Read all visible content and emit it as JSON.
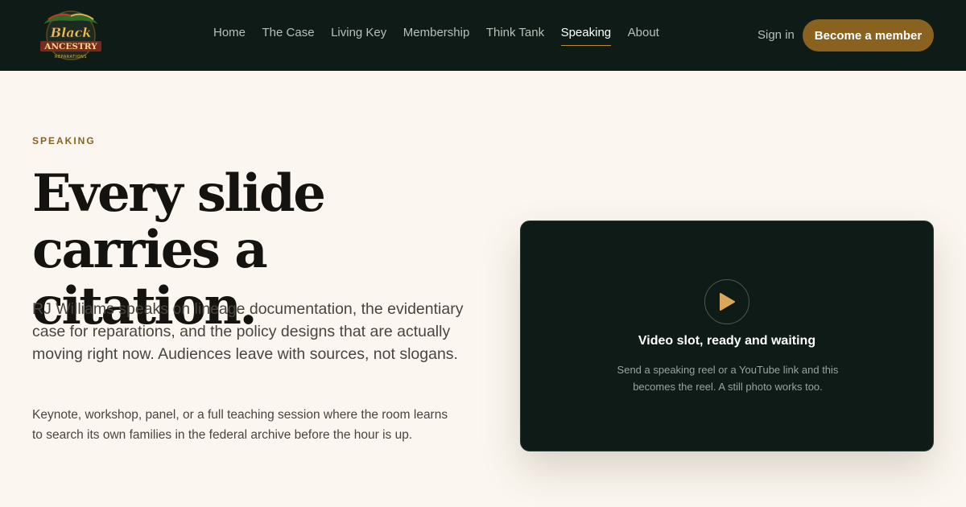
{
  "brand": {
    "logo_line1": "Black",
    "logo_line2": "ANCESTRY",
    "logo_line3": "REPARATIONS",
    "accent": "#8a6220",
    "dark_bg": "#0e1b17",
    "page_bg": "#fbf7f0"
  },
  "nav": {
    "items": [
      {
        "label": "Home"
      },
      {
        "label": "The Case"
      },
      {
        "label": "Living Key"
      },
      {
        "label": "Membership"
      },
      {
        "label": "Think Tank"
      },
      {
        "label": "Speaking",
        "active": true
      },
      {
        "label": "About"
      }
    ],
    "sign_in": "Sign in",
    "cta": "Become a member"
  },
  "hero": {
    "eyebrow": "SPEAKING",
    "headline_line1": "Every slide",
    "headline_line2": "carries a citation.",
    "lede": "RJ Williams speaks on lineage documentation, the evidentiary case for reparations, and the policy designs that are actually moving right now. Audiences leave with sources, not slogans.",
    "sub": "Keynote, workshop, panel, or a full teaching session where the room learns to search its own families in the federal archive before the hour is up."
  },
  "video": {
    "icon": "play-icon",
    "title": "Video slot, ready and waiting",
    "description": "Send a speaking reel or a YouTube link and this becomes the reel. A still photo works too."
  }
}
